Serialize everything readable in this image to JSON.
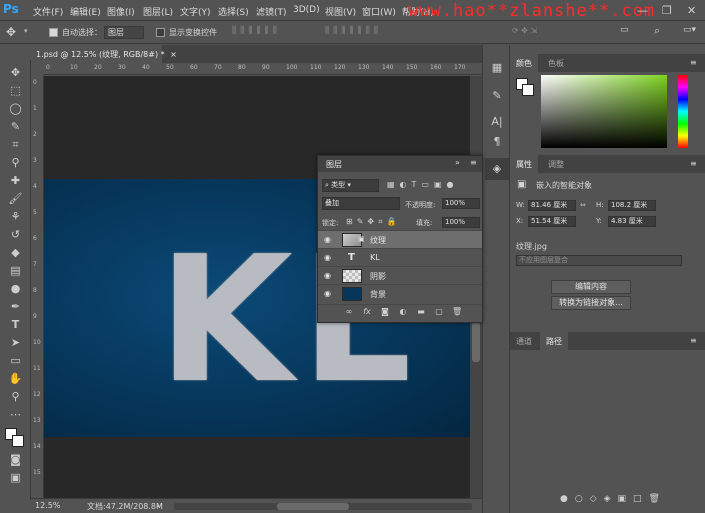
{
  "app": {
    "logo": "Ps"
  },
  "menu": [
    "文件(F)",
    "编辑(E)",
    "图像(I)",
    "图层(L)",
    "文字(Y)",
    "选择(S)",
    "滤镜(T)",
    "3D(D)",
    "视图(V)",
    "窗口(W)",
    "帮助(H)"
  ],
  "watermark": "www.hao**zlanshe**.com",
  "window_controls": {
    "minimize": "—",
    "restore": "❐",
    "close": "✕"
  },
  "options": {
    "auto_select_label": "自动选择：",
    "auto_select_value": "图层",
    "show_transform_label": "显示变换控件"
  },
  "document": {
    "tab_title": "1.psd @ 12.5% (纹理, RGB/8#) *",
    "tab_close": "×",
    "canvas_text": "KL"
  },
  "ruler_h": [
    "0",
    "10",
    "20",
    "30",
    "40",
    "50",
    "60",
    "70",
    "80",
    "90",
    "100",
    "110",
    "120",
    "130",
    "140",
    "150",
    "160",
    "170"
  ],
  "ruler_v": [
    "0",
    "1",
    "2",
    "3",
    "4",
    "5",
    "6",
    "7",
    "8",
    "9",
    "10",
    "11",
    "12",
    "13",
    "14",
    "15"
  ],
  "status": {
    "zoom": "12.5%",
    "doc_info": "文档:47.2M/208.8M"
  },
  "color_panel": {
    "tabs": [
      "颜色",
      "色板"
    ]
  },
  "properties_panel": {
    "tabs": [
      "属性",
      "调整"
    ],
    "heading": "嵌入的智能对象",
    "w_label": "W:",
    "w_value": "81.46 厘米",
    "h_label": "H:",
    "h_value": "108.2 厘米",
    "x_label": "X:",
    "x_value": "51.54 厘米",
    "y_label": "Y:",
    "y_value": "4.83 厘米",
    "file_name": "纹理.jpg",
    "layer_comp": "不应用图层复合",
    "edit_contents": "编辑内容",
    "convert_linked": "转换为链接对象..."
  },
  "bottom_panel": {
    "tabs": [
      "通道",
      "路径"
    ]
  },
  "layers_panel": {
    "title": "图层",
    "filter_type": "类型",
    "blend_mode": "叠加",
    "opacity_label": "不透明度:",
    "opacity_value": "100%",
    "lock_label": "锁定:",
    "fill_label": "填充:",
    "fill_value": "100%",
    "layers": [
      {
        "name": "纹理",
        "kind": "smart",
        "selected": true
      },
      {
        "name": "KL",
        "kind": "text",
        "selected": false
      },
      {
        "name": "阴影",
        "kind": "transparent",
        "selected": false
      },
      {
        "name": "背景",
        "kind": "fill",
        "selected": false
      }
    ]
  },
  "colors": {
    "ui_bg": "#535353",
    "doc_blue": "#06365a",
    "picker_green": "#7ed321"
  }
}
